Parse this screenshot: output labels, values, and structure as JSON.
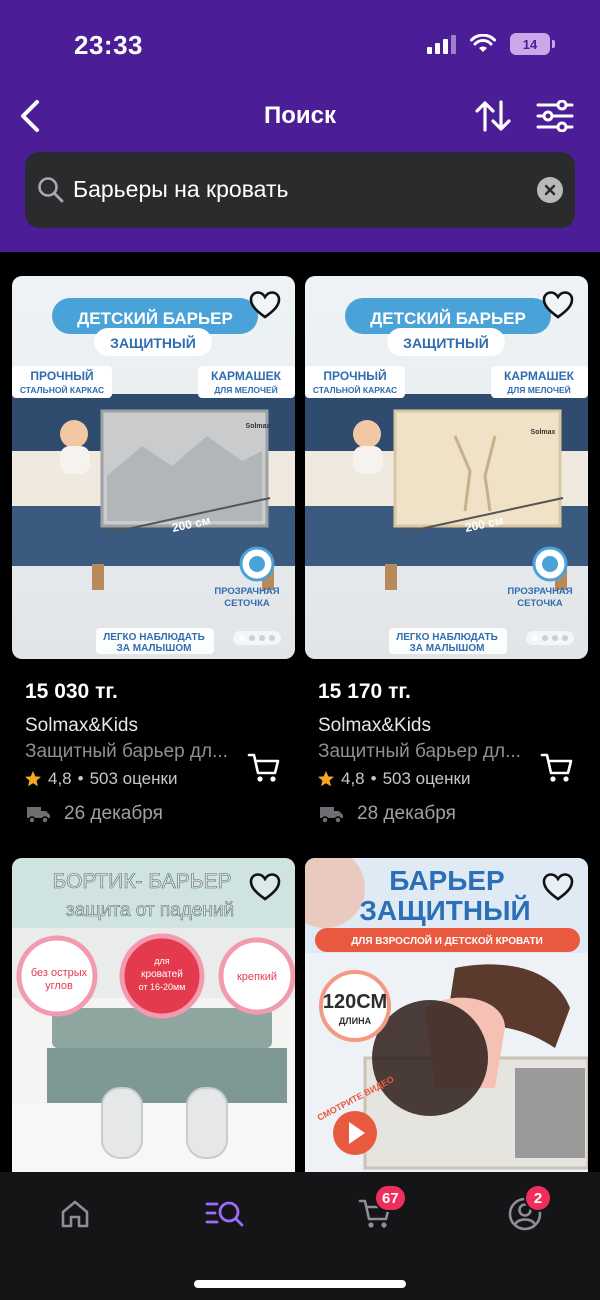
{
  "status_bar": {
    "time": "23:33",
    "battery": "14"
  },
  "header": {
    "title": "Поиск"
  },
  "search": {
    "value": "Барьеры на кровать"
  },
  "products": [
    {
      "price": "15 030 тг.",
      "brand": "Solmax&Kids",
      "name": "Защитный барьер дл...",
      "rating": "4,8",
      "reviews": "503 оценки",
      "delivery": "26 декабря",
      "image": {
        "title1": "ДЕТСКИЙ БАРЬЕР",
        "title2": "ЗАЩИТНЫЙ",
        "left1": "ПРОЧНЫЙ",
        "left2": "СТАЛЬНОЙ КАРКАС",
        "right1": "КАРМАШЕК",
        "right2": "ДЛЯ МЕЛОЧЕЙ",
        "size": "200 см",
        "mesh1": "ПРОЗРАЧНАЯ",
        "mesh2": "СЕТОЧКА",
        "bottom1": "ЛЕГКО НАБЛЮДАТЬ",
        "bottom2": "ЗА МАЛЫШОМ",
        "brand_label": "Solmax"
      }
    },
    {
      "price": "15 170 тг.",
      "brand": "Solmax&Kids",
      "name": "Защитный барьер дл...",
      "rating": "4,8",
      "reviews": "503 оценки",
      "delivery": "28 декабря",
      "image": {
        "title1": "ДЕТСКИЙ БАРЬЕР",
        "title2": "ЗАЩИТНЫЙ",
        "left1": "ПРОЧНЫЙ",
        "left2": "СТАЛЬНОЙ КАРКАС",
        "right1": "КАРМАШЕК",
        "right2": "ДЛЯ МЕЛОЧЕЙ",
        "size": "200 см",
        "mesh1": "ПРОЗРАЧНАЯ",
        "mesh2": "СЕТОЧКА",
        "bottom1": "ЛЕГКО НАБЛЮДАТЬ",
        "bottom2": "ЗА МАЛЫШОМ",
        "brand_label": "Solmax"
      }
    },
    {
      "image": {
        "title1": "БОРТИК- БАРЬЕР",
        "title2": "защита от падений",
        "c1a": "без острых",
        "c1b": "углов",
        "c2a": "для",
        "c2b": "кроватей",
        "c2c": "от 16-20мм",
        "c3": "крепкий"
      }
    },
    {
      "image": {
        "title1": "БАРЬЕР",
        "title2": "ЗАЩИТНЫЙ",
        "ribbon": "ДЛЯ ВЗРОСЛОЙ И ДЕТСКОЙ КРОВАТИ",
        "len": "120СМ",
        "len2": "ДЛИНА",
        "video": "СМОТРИТЕ ВИДЕО"
      }
    }
  ],
  "tabbar": {
    "cart_badge": "67",
    "profile_badge": "2"
  },
  "colors": {
    "header_bg": "#4b1d97",
    "accent": "#9f6bff",
    "badge": "#ef2e5d",
    "star": "#f5a623"
  }
}
